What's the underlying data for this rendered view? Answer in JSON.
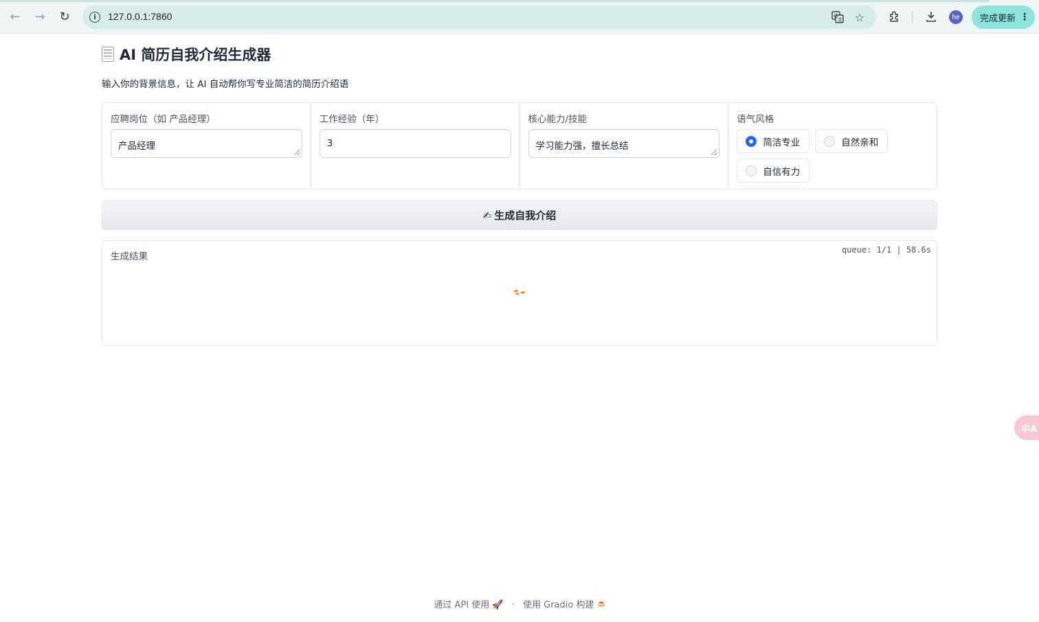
{
  "browser": {
    "url": "127.0.0.1:7860",
    "update_button_label": "完成更新",
    "update_button_menu": "⋮",
    "avatar_initials": "he",
    "icons": [
      "back-icon",
      "forward-icon",
      "reload-icon",
      "info-icon",
      "translate-icon",
      "bookmark-star-icon",
      "extensions-icon",
      "download-icon"
    ]
  },
  "page": {
    "title_icon": "document-icon",
    "title": "AI 简历自我介绍生成器",
    "subtitle": "输入你的背景信息，让 AI 自动帮你写专业简洁的简历介绍语"
  },
  "form": {
    "position": {
      "label": "应聘岗位（如 产品经理）",
      "value": "产品经理"
    },
    "experience": {
      "label": "工作经验（年）",
      "value": "3"
    },
    "skills": {
      "label": "核心能力/技能",
      "value": "学习能力强，擅长总结"
    },
    "tone": {
      "label": "语气风格",
      "options": [
        "简洁专业",
        "自然亲和",
        "自信有力"
      ],
      "selected": "简洁专业"
    }
  },
  "generate_button": {
    "icon": "✍",
    "label": "生成自我介绍"
  },
  "output": {
    "label": "生成结果",
    "queue_status": "queue: 1/1 | 58.6s"
  },
  "floating_translate_button": "中A",
  "footer": {
    "api_link": "通过 API 使用",
    "separator": "·",
    "gradio_link": "使用 Gradio 构建"
  },
  "colors": {
    "accent": "#2563eb",
    "loader": "#f97316",
    "chrome_bg": "#eef5f4",
    "update_button": "#8ce4dc"
  }
}
